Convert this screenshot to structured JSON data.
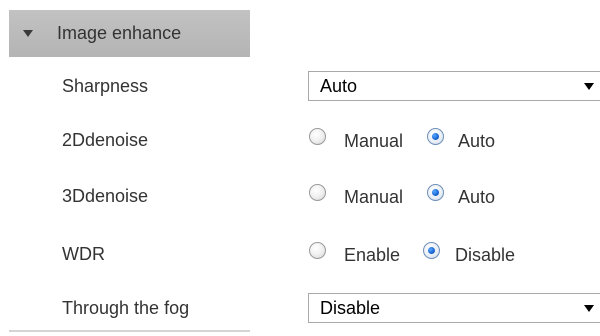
{
  "section": {
    "title": "Image enhance",
    "icon": "triangle-down-icon"
  },
  "rows": {
    "sharpness": {
      "label": "Sharpness",
      "value": "Auto"
    },
    "denoise2d": {
      "label": "2Ddenoise",
      "options": [
        "Manual",
        "Auto"
      ],
      "selected": "Auto"
    },
    "denoise3d": {
      "label": "3Ddenoise",
      "options": [
        "Manual",
        "Auto"
      ],
      "selected": "Auto"
    },
    "wdr": {
      "label": "WDR",
      "options": [
        "Enable",
        "Disable"
      ],
      "selected": "Disable"
    },
    "fog": {
      "label": "Through the fog",
      "value": "Disable"
    }
  },
  "colors": {
    "header_bg": "#b8b8b8",
    "radio_selected": "#1d6ad6",
    "select_border": "#a9a9a9"
  }
}
